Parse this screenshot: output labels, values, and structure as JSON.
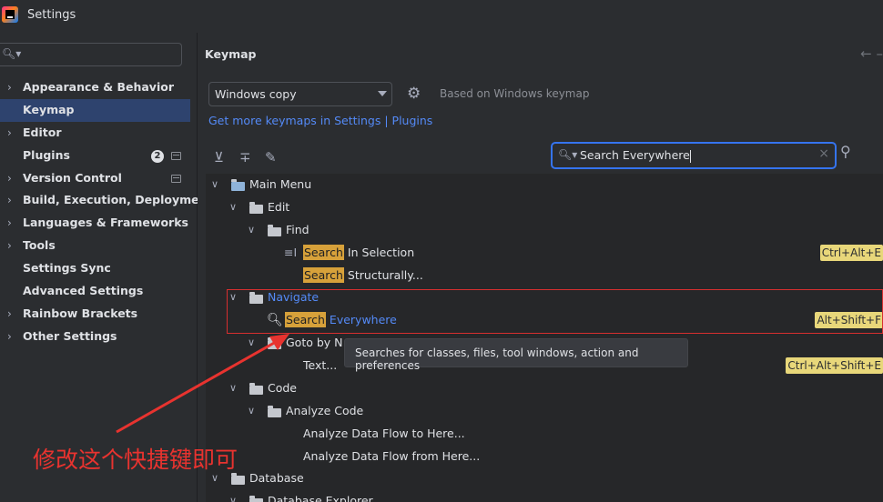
{
  "window": {
    "title": "Settings"
  },
  "sidebar": {
    "search_placeholder": "",
    "items": [
      {
        "label": "Appearance & Behavior",
        "expandable": true,
        "selected": false
      },
      {
        "label": "Keymap",
        "expandable": false,
        "selected": true
      },
      {
        "label": "Editor",
        "expandable": true,
        "selected": false
      },
      {
        "label": "Plugins",
        "expandable": false,
        "selected": false,
        "badge": "2"
      },
      {
        "label": "Version Control",
        "expandable": true,
        "selected": false
      },
      {
        "label": "Build, Execution, Deployment",
        "expandable": true,
        "selected": false
      },
      {
        "label": "Languages & Frameworks",
        "expandable": true,
        "selected": false
      },
      {
        "label": "Tools",
        "expandable": true,
        "selected": false
      },
      {
        "label": "Settings Sync",
        "expandable": false,
        "selected": false
      },
      {
        "label": "Advanced Settings",
        "expandable": false,
        "selected": false
      },
      {
        "label": "Rainbow Brackets",
        "expandable": true,
        "selected": false
      },
      {
        "label": "Other Settings",
        "expandable": true,
        "selected": false
      }
    ]
  },
  "keymap": {
    "title": "Keymap",
    "selected_keymap": "Windows copy",
    "based_on": "Based on Windows keymap",
    "more_link": "Get more keymaps in Settings | Plugins",
    "search_value": "Search Everywhere"
  },
  "tree": {
    "main_menu": "Main Menu",
    "edit": "Edit",
    "find": "Find",
    "search_in_selection": {
      "hl": "Search",
      "rest": " In Selection",
      "shortcut": "Ctrl+Alt+E"
    },
    "search_structurally": {
      "hl": "Search",
      "rest": " Structurally..."
    },
    "navigate": "Navigate",
    "search_everywhere": {
      "hl": "Search",
      "rest": " Everywhere",
      "shortcut": "Alt+Shift+F"
    },
    "goto_by_name": "Goto by N",
    "text": {
      "label": "Text...",
      "shortcut": "Ctrl+Alt+Shift+E"
    },
    "code": "Code",
    "analyze_code": "Analyze Code",
    "analyze_to_here": "Analyze Data Flow to Here...",
    "analyze_from_here": "Analyze Data Flow from Here...",
    "database": "Database",
    "database_explorer": "Database Explorer"
  },
  "tooltip": "Searches for classes, files, tool windows, action and preferences",
  "annotation": "修改这个快捷键即可",
  "colors": {
    "accent": "#3574f0",
    "highlight": "#d7a13a",
    "shortcut_bg": "#e8d77a",
    "annotation_red": "#e8332f",
    "selected_bg": "#2e436e"
  }
}
